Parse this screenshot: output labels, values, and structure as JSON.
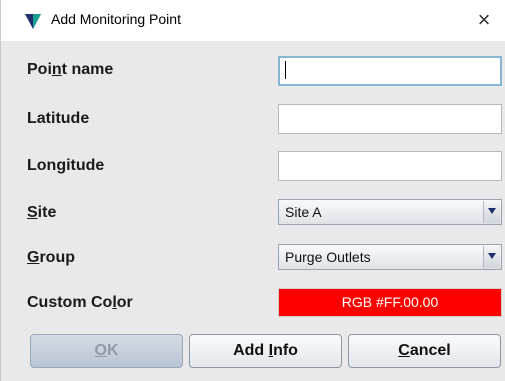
{
  "window": {
    "title": "Add Monitoring Point",
    "close_glyph": "×",
    "app_icon": "triangle-logo-icon",
    "close_icon": "close-icon"
  },
  "form": {
    "point_name": {
      "label_pre": "Poi",
      "label_accel": "n",
      "label_post": "t name",
      "value": ""
    },
    "latitude": {
      "label": "Latitude",
      "value": ""
    },
    "longitude": {
      "label": "Longitude",
      "value": ""
    },
    "site": {
      "label_accel": "S",
      "label_post": "ite",
      "selected": "Site A",
      "arrow_icon": "chevron-down-icon"
    },
    "group": {
      "label_accel": "G",
      "label_post": "roup",
      "selected": "Purge Outlets",
      "arrow_icon": "chevron-down-icon"
    },
    "custom_color": {
      "label_pre": "Custom Co",
      "label_accel": "l",
      "label_post": "or",
      "value": "RGB #FF.00.00",
      "color": "#ff0000"
    }
  },
  "buttons": {
    "ok": {
      "label_accel": "O",
      "label_post": "K",
      "enabled": false
    },
    "add_info": {
      "label_pre": "Add ",
      "label_accel": "I",
      "label_post": "nfo"
    },
    "cancel": {
      "label_accel": "C",
      "label_post": "ancel"
    }
  },
  "colors": {
    "dialog_bg": "#e9e9e9",
    "titlebar_bg": "#ffffff",
    "accent_blue": "#1f2f6e",
    "logo_teal": "#1aa090",
    "focus_border": "#8ab6d6"
  }
}
